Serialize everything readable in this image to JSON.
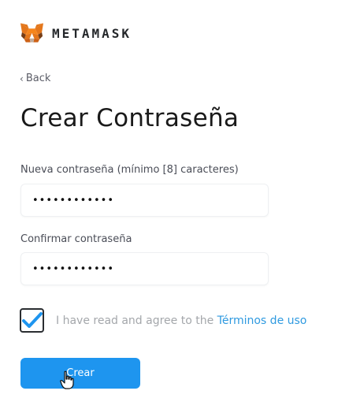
{
  "header": {
    "brand": "METAMASK",
    "logo_icon": "fox-icon"
  },
  "back": {
    "label": "Back",
    "icon": "chevron-left-icon"
  },
  "title": "Crear Contraseña",
  "new_password": {
    "label": "Nueva contraseña (mínimo [8] caracteres)",
    "value": "••••••••••••"
  },
  "confirm_password": {
    "label": "Confirmar contraseña",
    "value": "••••••••••••"
  },
  "agreement": {
    "checked": true,
    "text": "I have read and agree to the ",
    "link": "Términos de uso"
  },
  "create_button": {
    "label": "Crear"
  },
  "colors": {
    "accent": "#1e95ef",
    "link": "#2f9ae0",
    "checkmark": "#1e95ef",
    "fox_orange": "#e2761b"
  }
}
